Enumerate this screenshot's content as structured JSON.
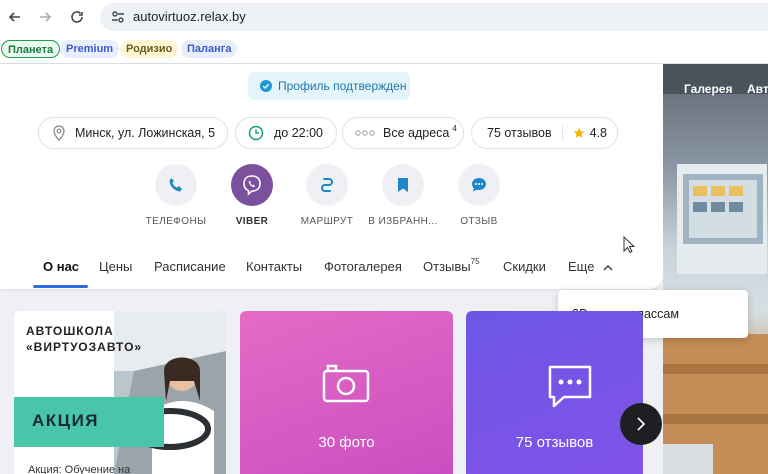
{
  "browser": {
    "url": "autovirtuoz.relax.by",
    "bookmarks": [
      "Планета",
      "Premium",
      "Родизио",
      "Паланга"
    ]
  },
  "header": {
    "verified_label": "Профиль подтвержден"
  },
  "info_chips": {
    "address": "Минск, ул. Ложинская, 5",
    "hours": "до 22:00",
    "all_addresses": "Все адреса",
    "all_addresses_count": "4",
    "reviews": "75 отзывов",
    "rating": "4.8"
  },
  "actions": [
    {
      "label": "ТЕЛЕФОНЫ",
      "icon": "phone-icon"
    },
    {
      "label": "VIBER",
      "icon": "viber-icon"
    },
    {
      "label": "МАРШРУТ",
      "icon": "route-icon"
    },
    {
      "label": "В ИЗБРАНН...",
      "icon": "bookmark-icon"
    },
    {
      "label": "ОТЗЫВ",
      "icon": "chat-icon"
    }
  ],
  "tabs": [
    {
      "label": "О нас"
    },
    {
      "label": "Цены"
    },
    {
      "label": "Расписание"
    },
    {
      "label": "Контакты"
    },
    {
      "label": "Фотогалерея"
    },
    {
      "label": "Отзывы",
      "badge": "75"
    },
    {
      "label": "Скидки"
    },
    {
      "label": "Еще"
    }
  ],
  "dropdown": {
    "items": [
      "3D тур по классам"
    ]
  },
  "gallery": {
    "tabs": [
      "Галерея",
      "Авт"
    ]
  },
  "tiles": {
    "promo_heading_line1": "АВТОШКОЛА",
    "promo_heading_line2": "«ВИРТУОЗАВТО»",
    "promo_label": "АКЦИЯ",
    "promo_caption": "Акция: Обучение на",
    "photos_caption": "30 фото",
    "reviews_caption": "75 отзывов"
  },
  "colors": {
    "accent": "#2e6fe0",
    "viber": "#7b519d",
    "verified_bg": "#e4f4fb",
    "verified_text": "#1f78a8",
    "star": "#f5b400"
  }
}
